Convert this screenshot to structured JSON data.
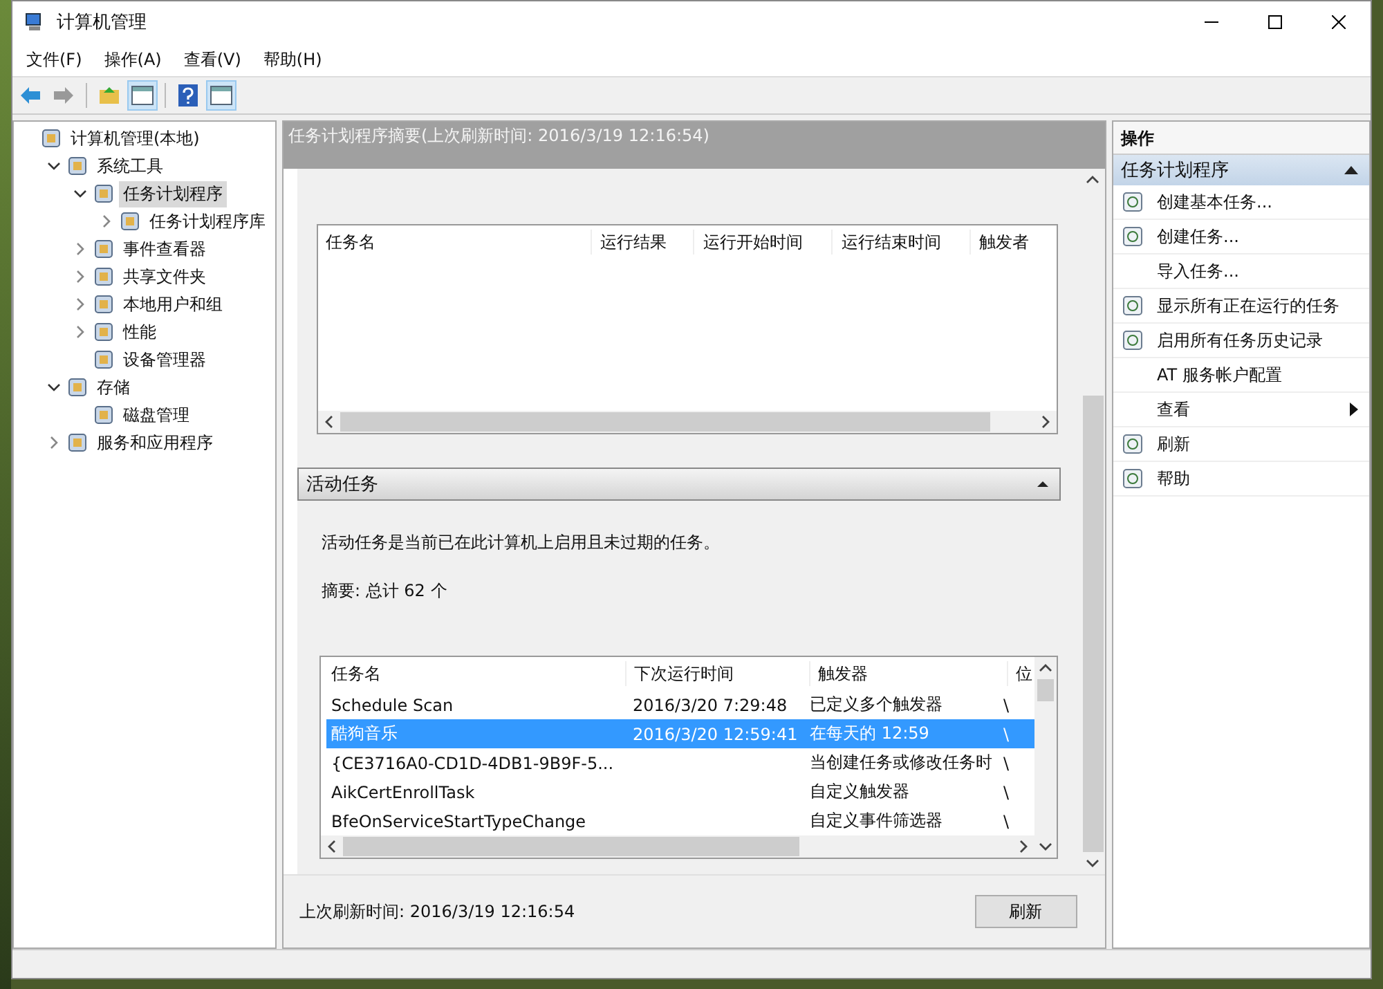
{
  "window": {
    "title": "计算机管理"
  },
  "menu": [
    "文件(F)",
    "操作(A)",
    "查看(V)",
    "帮助(H)"
  ],
  "tree": [
    {
      "label": "计算机管理(本地)",
      "selected": false,
      "children": [
        {
          "label": "系统工具",
          "expanded": true,
          "selected": false,
          "children": [
            {
              "label": "任务计划程序",
              "expanded": true,
              "selected": true,
              "children": [
                {
                  "label": "任务计划程序库",
                  "expanded": false,
                  "selected": false
                }
              ]
            },
            {
              "label": "事件查看器",
              "expanded": false,
              "selected": false
            },
            {
              "label": "共享文件夹",
              "expanded": false,
              "selected": false
            },
            {
              "label": "本地用户和组",
              "expanded": false,
              "selected": false
            },
            {
              "label": "性能",
              "expanded": false,
              "selected": false
            },
            {
              "label": "设备管理器",
              "selected": false
            }
          ]
        },
        {
          "label": "存储",
          "expanded": true,
          "selected": false,
          "children": [
            {
              "label": "磁盘管理",
              "selected": false
            }
          ]
        },
        {
          "label": "服务和应用程序",
          "expanded": false,
          "selected": false
        }
      ]
    }
  ],
  "main": {
    "header": "任务计划程序摘要(上次刷新时间: 2016/3/19 12:16:54)",
    "status_table": {
      "columns": [
        "任务名",
        "运行结果",
        "运行开始时间",
        "运行结束时间",
        "触发者"
      ]
    },
    "active_section": {
      "title": "活动任务",
      "expanded": true,
      "description": "活动任务是当前已在此计算机上启用且未过期的任务。",
      "summary": "摘要: 总计 62 个",
      "table": {
        "columns": [
          "任务名",
          "下次运行时间",
          "触发器",
          "位"
        ],
        "rows": [
          {
            "cells": [
              "Schedule Scan",
              "2016/3/20 7:29:48",
              "已定义多个触发器",
              "\\"
            ],
            "selected": false
          },
          {
            "cells": [
              "酷狗音乐",
              "2016/3/20 12:59:41",
              "在每天的 12:59",
              "\\"
            ],
            "selected": true
          },
          {
            "cells": [
              "{CE3716A0-CD1D-4DB1-9B9F-5...",
              "",
              "当创建任务或修改任务时",
              "\\"
            ],
            "selected": false
          },
          {
            "cells": [
              "AikCertEnrollTask",
              "",
              "自定义触发器",
              "\\"
            ],
            "selected": false
          },
          {
            "cells": [
              "BfeOnServiceStartTypeChange",
              "",
              "自定义事件筛选器",
              "\\"
            ],
            "selected": false
          }
        ]
      }
    },
    "footer": {
      "last_refresh": "上次刷新时间: 2016/3/19 12:16:54",
      "refresh_button": "刷新"
    }
  },
  "actions": {
    "title": "操作",
    "section": {
      "title": "任务计划程序",
      "expanded": true
    },
    "items": [
      {
        "label": "创建基本任务...",
        "icon": true,
        "submenu": false
      },
      {
        "label": "创建任务...",
        "icon": true,
        "submenu": false
      },
      {
        "label": "导入任务...",
        "icon": false,
        "submenu": false
      },
      {
        "label": "显示所有正在运行的任务",
        "icon": true,
        "submenu": false
      },
      {
        "label": "启用所有任务历史记录",
        "icon": true,
        "submenu": false
      },
      {
        "label": "AT 服务帐户配置",
        "icon": false,
        "submenu": false
      },
      {
        "label": "查看",
        "icon": false,
        "submenu": true
      },
      {
        "label": "刷新",
        "icon": true,
        "submenu": false
      },
      {
        "label": "帮助",
        "icon": true,
        "submenu": false
      }
    ]
  }
}
